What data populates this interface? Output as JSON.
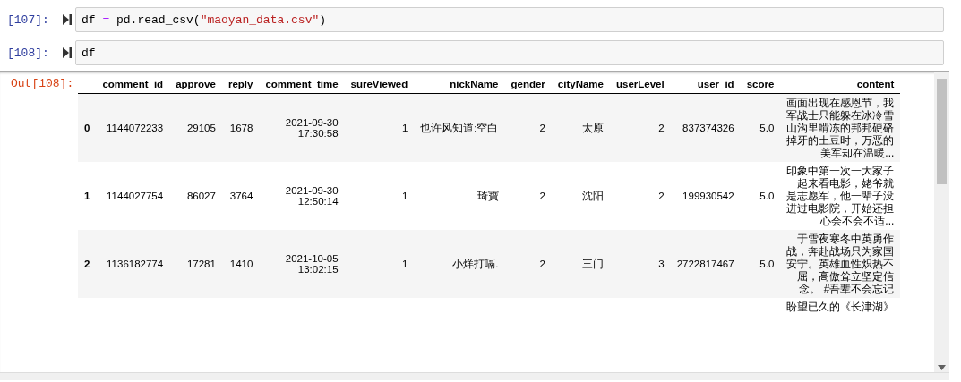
{
  "cells": [
    {
      "prompt": "[107]:",
      "code": [
        {
          "text": "df ",
          "kind": "name"
        },
        {
          "text": "=",
          "kind": "operator"
        },
        {
          "text": " pd.read_csv(",
          "kind": "name"
        },
        {
          "text": "\"maoyan_data.csv\"",
          "kind": "string"
        },
        {
          "text": ")",
          "kind": "name"
        }
      ]
    },
    {
      "prompt": "[108]:",
      "code": [
        {
          "text": "df",
          "kind": "name"
        }
      ]
    }
  ],
  "output": {
    "prompt": "Out[108]:",
    "table": {
      "columns": [
        "comment_id",
        "approve",
        "reply",
        "comment_time",
        "sureViewed",
        "nickName",
        "gender",
        "cityName",
        "userLevel",
        "user_id",
        "score",
        "content"
      ],
      "rows": [
        {
          "index": "0",
          "cells": [
            "1144072233",
            "29105",
            "1678",
            "2021-09-30 17:30:58",
            "1",
            "也许风知道:空白",
            "2",
            "太原",
            "2",
            "837374326",
            "5.0",
            "画面出现在感恩节，我军战士只能躲在冰冷雪山沟里啃冻的邦邦硬硌掉牙的土豆时，万恶的美军却在温暖..."
          ]
        },
        {
          "index": "1",
          "cells": [
            "1144027754",
            "86027",
            "3764",
            "2021-09-30 12:50:14",
            "1",
            "琦寶",
            "2",
            "沈阳",
            "2",
            "199930542",
            "5.0",
            "印象中第一次一大家子一起来看电影，姥爷就是志愿军，他一辈子没进过电影院，开始还担心会不会不适..."
          ]
        },
        {
          "index": "2",
          "cells": [
            "1136182774",
            "17281",
            "1410",
            "2021-10-05 13:02:15",
            "1",
            "小烊打嗝.",
            "2",
            "三门",
            "3",
            "2722817467",
            "5.0",
            "于雪夜寒冬中英勇作战，奔赴战场只为家国安宁。英雄血性炽热不屈，高傲耸立坚定信念。 #吾辈不会忘记"
          ]
        }
      ],
      "partial_row_content": "盼望已久的《长津湖》"
    }
  }
}
